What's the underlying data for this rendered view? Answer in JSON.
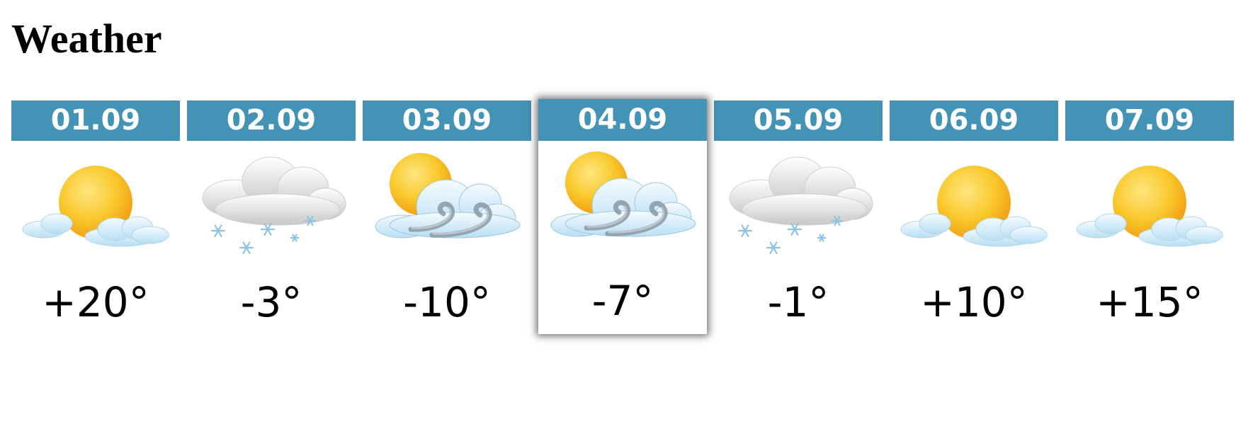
{
  "page": {
    "title": "Weather"
  },
  "colors": {
    "header_background": "#4393b7",
    "header_text": "#ffffff",
    "temperature_text": "#000000"
  },
  "forecast": [
    {
      "date": "01.09",
      "temperature": "+20°",
      "icon": "sun-cloud-icon",
      "selected": false
    },
    {
      "date": "02.09",
      "temperature": "-3°",
      "icon": "snow-cloud-icon",
      "selected": false
    },
    {
      "date": "03.09",
      "temperature": "-10°",
      "icon": "sun-wind-icon",
      "selected": false
    },
    {
      "date": "04.09",
      "temperature": "-7°",
      "icon": "sun-wind-icon",
      "selected": true
    },
    {
      "date": "05.09",
      "temperature": "-1°",
      "icon": "snow-cloud-icon",
      "selected": false
    },
    {
      "date": "06.09",
      "temperature": "+10°",
      "icon": "sun-cloud-icon",
      "selected": false
    },
    {
      "date": "07.09",
      "temperature": "+15°",
      "icon": "sun-cloud-icon",
      "selected": false
    }
  ]
}
